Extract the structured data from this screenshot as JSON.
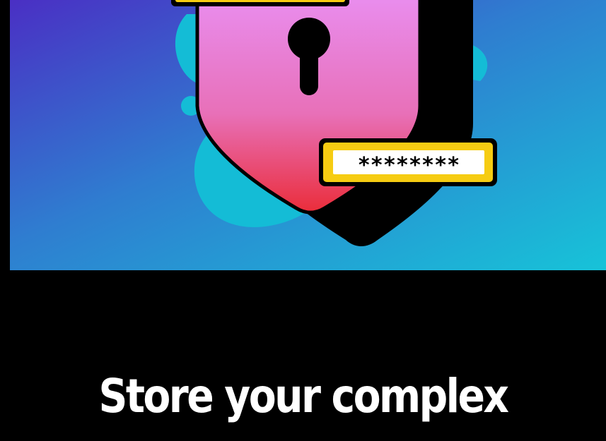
{
  "hero": {
    "password_mask": "********"
  },
  "headline": {
    "text": "Store your complex"
  },
  "colors": {
    "gradient_start": "#4a2fc4",
    "gradient_mid": "#2f7dd0",
    "gradient_end": "#17c3d8",
    "blob": "#14bcd6",
    "shield_top": "#e98ef0",
    "shield_bottom": "#ea2d3a",
    "field_border": "#f6cc12"
  }
}
